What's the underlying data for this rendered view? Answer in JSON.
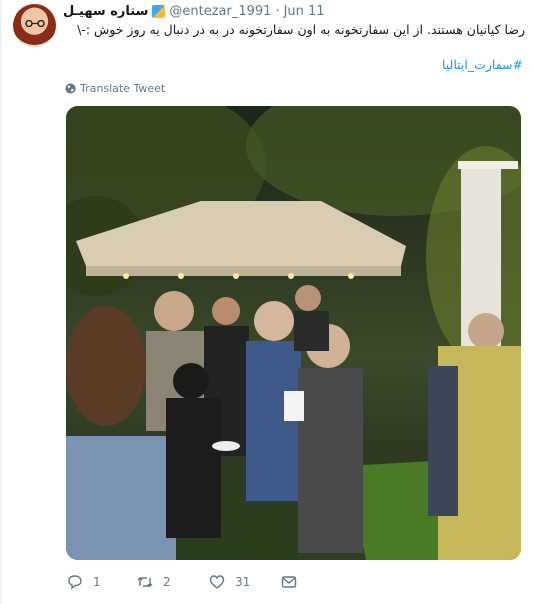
{
  "author": {
    "display_name": "ستاره سهیـل",
    "handle": "@entezar_1991",
    "separator": "·",
    "date": "Jun 11"
  },
  "tweet": {
    "text": "رضا کیانیان هستند. از این سفارتخونه به اون سفارتخونه در به در دنبال یه روز خوش :-\\",
    "hashtag": "#سفارت_ایتالیا",
    "translate_label": "Translate Tweet"
  },
  "actions": {
    "reply_count": "1",
    "retweet_count": "2",
    "like_count": "31"
  },
  "colors": {
    "link": "#1b95e0",
    "muted": "#657786",
    "text": "#14171a"
  },
  "icons": [
    "avatar",
    "emoji-icon",
    "globe-icon",
    "reply-icon",
    "retweet-icon",
    "like-icon",
    "message-icon"
  ]
}
